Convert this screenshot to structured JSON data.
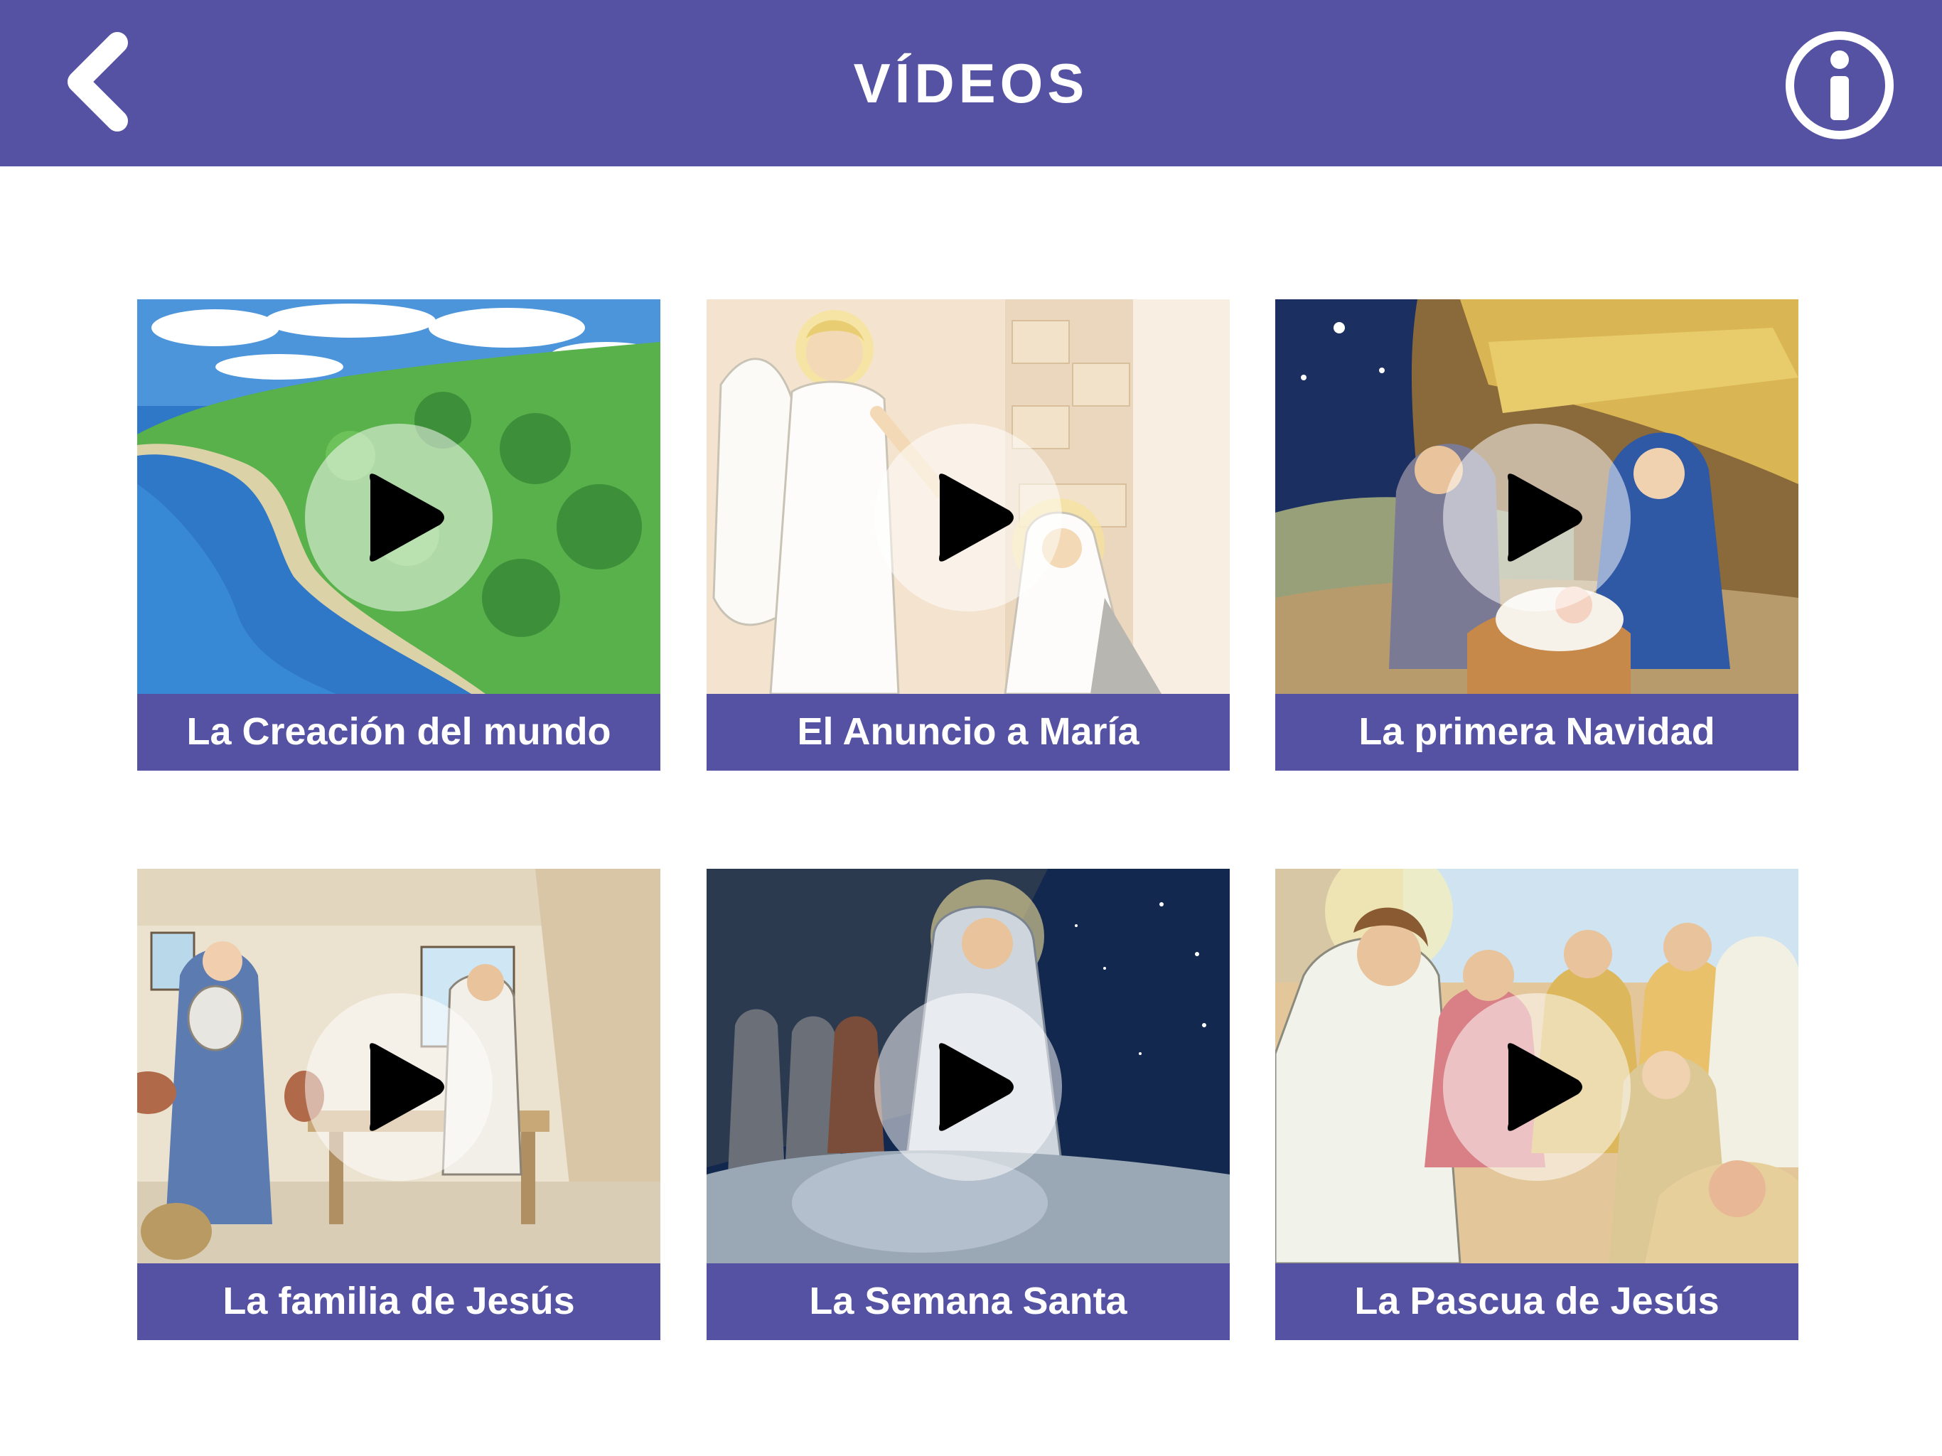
{
  "header": {
    "title": "VÍDEOS",
    "back_icon": "chevron-left-icon",
    "info_icon": "info-circle-icon",
    "background": "#5652a3"
  },
  "videos": [
    {
      "title": "La Creación del mundo",
      "thumbnail": "island-coast-illustration"
    },
    {
      "title": "El Anuncio a María",
      "thumbnail": "angel-and-mary-illustration"
    },
    {
      "title": "La primera Navidad",
      "thumbnail": "nativity-illustration"
    },
    {
      "title": "La familia de Jesús",
      "thumbnail": "carpenter-workshop-illustration"
    },
    {
      "title": "La Semana Santa",
      "thumbnail": "garden-night-prayer-illustration"
    },
    {
      "title": "La Pascua de Jesús",
      "thumbnail": "jesus-with-disciples-illustration"
    }
  ],
  "colors": {
    "accent": "#5652a3",
    "label_text": "#ffffff",
    "play_icon": "#000000"
  }
}
